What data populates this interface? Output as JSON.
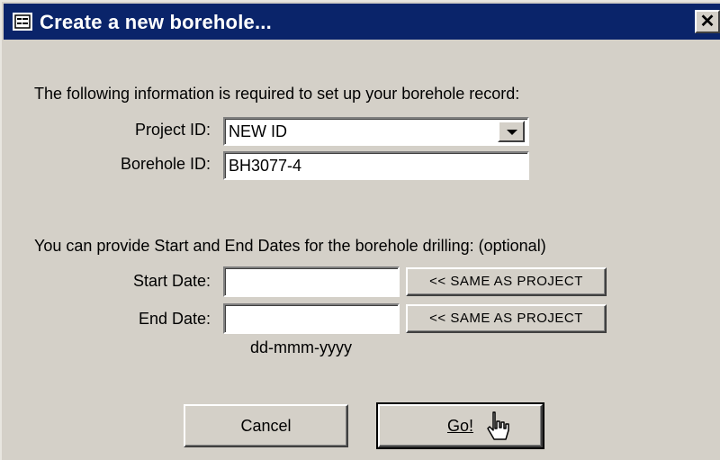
{
  "window": {
    "title": "Create a new borehole...",
    "close_label": "✕"
  },
  "form": {
    "intro": "The following information is required to set up your borehole record:",
    "project_id": {
      "label": "Project ID:",
      "value": "NEW ID"
    },
    "borehole_id": {
      "label": "Borehole ID:",
      "value": "BH3077-4"
    },
    "dates_intro": "You can provide Start and End Dates for the borehole drilling: (optional)",
    "start_date": {
      "label": "Start Date:",
      "value": "",
      "same_label": "<< SAME AS PROJECT"
    },
    "end_date": {
      "label": "End Date:",
      "value": "",
      "same_label": "<< SAME AS PROJECT"
    },
    "date_format_hint": "dd-mmm-yyyy"
  },
  "buttons": {
    "cancel_label": "Cancel",
    "go_label": "Go!"
  },
  "colors": {
    "titlebar": "#0a246a",
    "face": "#d4d0c8"
  }
}
